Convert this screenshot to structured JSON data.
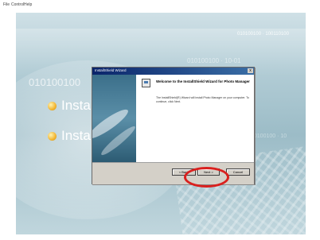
{
  "menu": {
    "items": [
      "File",
      "Control",
      "Help"
    ]
  },
  "background": {
    "binary_top": "010100100 · 100110100",
    "binary_mid": "010100100 · 10-01",
    "binary_left": "010100100",
    "binary_right": "10100100 · 10"
  },
  "installer_items": [
    "Insta",
    "Insta"
  ],
  "dialog": {
    "title": "InstallShield Wizard",
    "close_label": "x",
    "welcome": "Welcome to the InstallShield Wizard for Photo Manager",
    "description": "The InstallShield(R) Wizard will install Photo Manager on your computer. To continue, click Next.",
    "buttons": {
      "back": "< Back",
      "next": "Next >",
      "cancel": "Cancel"
    }
  },
  "colors": {
    "highlight": "#d9201e",
    "titlebar": "#0a246a"
  }
}
